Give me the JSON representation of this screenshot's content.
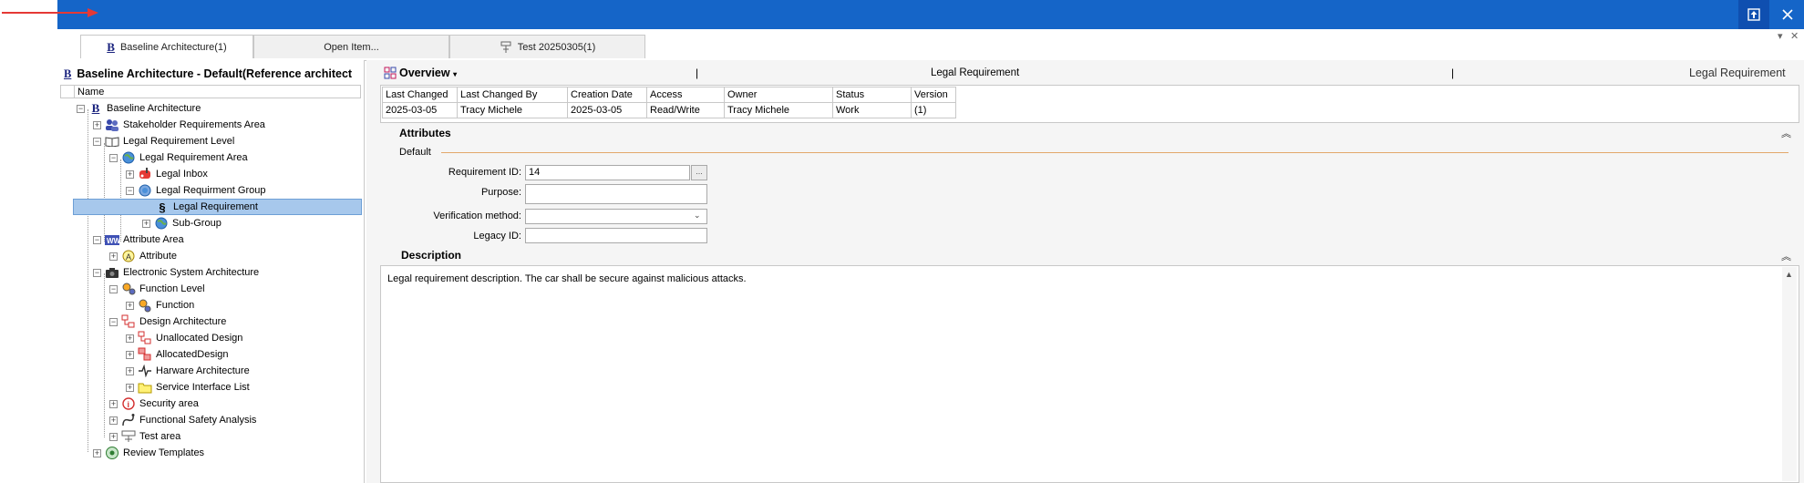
{
  "titlebar": {
    "restore_icon": "restore-icon",
    "close_icon": "close-icon",
    "color": "#1565c8"
  },
  "tabs": [
    {
      "label": "Baseline Architecture(1)",
      "icon": "baseline-b-icon",
      "active": true
    },
    {
      "label": "Open Item...",
      "active": false
    },
    {
      "label": "Test 20250305(1)",
      "icon": "test-flask-icon",
      "active": false
    }
  ],
  "tree": {
    "title": "Baseline Architecture - Default(Reference architect",
    "column_header": "Name",
    "items": [
      {
        "label": "Baseline Architecture",
        "icon": "baseline-b-icon"
      },
      {
        "label": "Stakeholder Requirements Area",
        "icon": "people-icon"
      },
      {
        "label": "Legal Requirement Level",
        "icon": "book-icon"
      },
      {
        "label": "Legal Requirement Area",
        "icon": "globe-icon"
      },
      {
        "label": "Legal Inbox",
        "icon": "mailbox-icon"
      },
      {
        "label": "Legal Requirment Group",
        "icon": "globe-group-icon"
      },
      {
        "label": "Legal Requirement",
        "icon": "paragraph-icon",
        "selected": true
      },
      {
        "label": "Sub-Group",
        "icon": "globe-icon"
      },
      {
        "label": "Attribute Area",
        "icon": "ww-icon"
      },
      {
        "label": "Attribute",
        "icon": "attribute-a-icon"
      },
      {
        "label": "Electronic System Architecture",
        "icon": "camera-icon"
      },
      {
        "label": "Function Level",
        "icon": "function-gears-icon"
      },
      {
        "label": "Function",
        "icon": "gear-icon"
      },
      {
        "label": "Design Architecture",
        "icon": "design-icon"
      },
      {
        "label": "Unallocated Design",
        "icon": "design-icon"
      },
      {
        "label": "AllocatedDesign",
        "icon": "design-red-icon"
      },
      {
        "label": "Harware Architecture",
        "icon": "hardware-icon"
      },
      {
        "label": "Service Interface List",
        "icon": "folder-icon"
      },
      {
        "label": "Security area",
        "icon": "info-red-icon"
      },
      {
        "label": "Functional Safety Analysis",
        "icon": "safety-icon"
      },
      {
        "label": "Test area",
        "icon": "test-icon"
      },
      {
        "label": "Review Templates",
        "icon": "review-icon"
      }
    ]
  },
  "overview": {
    "label": "Overview",
    "separator": "|",
    "center_title": "Legal Requirement",
    "right_title": "Legal Requirement"
  },
  "meta": {
    "headers": [
      "Last Changed",
      "Last Changed By",
      "Creation Date",
      "Access",
      "Owner",
      "Status",
      "Version"
    ],
    "values": [
      "2025-03-05",
      "Tracy Michele",
      "2025-03-05",
      "Read/Write",
      "Tracy Michele",
      "Work",
      "(1)"
    ]
  },
  "attributes": {
    "title": "Attributes",
    "group": "Default",
    "requirement_id_label": "Requirement ID:",
    "requirement_id_value": "14",
    "browse_label": "...",
    "purpose_label": "Purpose:",
    "purpose_value": "",
    "verification_label": "Verification method:",
    "verification_value": "",
    "legacy_label": "Legacy ID:",
    "legacy_value": ""
  },
  "description": {
    "title": "Description",
    "text": "Legal requirement description. The car shall be secure against malicious attacks."
  }
}
